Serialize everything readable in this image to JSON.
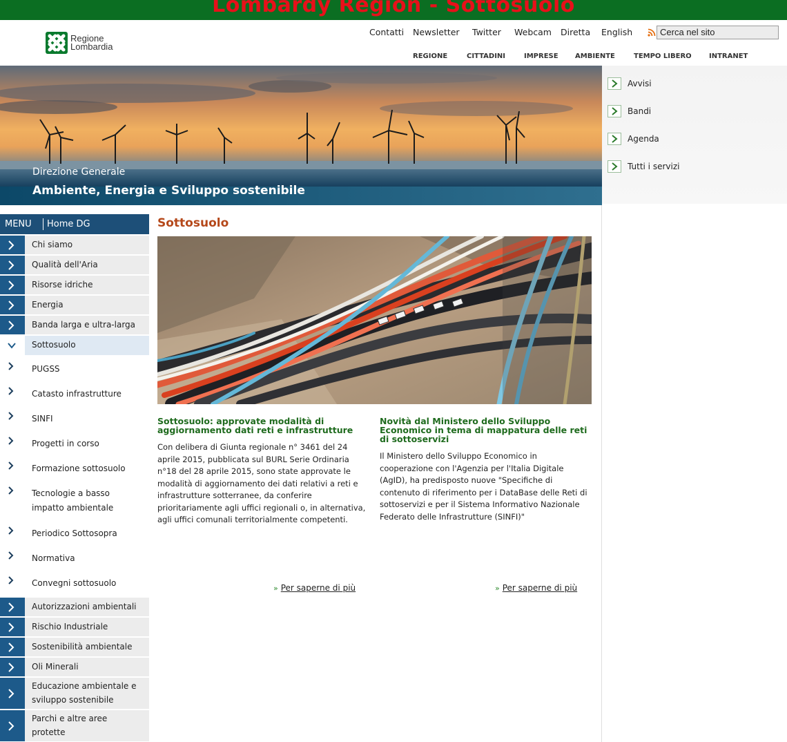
{
  "top_strip": {
    "text": "Lombardy Region - Sottosuolo"
  },
  "brand": {
    "line1": "Regione",
    "line2": "Lombardia"
  },
  "utility_links": [
    "Contatti",
    "Newsletter",
    "Twitter",
    "Webcam",
    "Diretta",
    "English"
  ],
  "search": {
    "value": "Cerca nel sito"
  },
  "main_nav": [
    "REGIONE",
    "CITTADINI",
    "IMPRESE",
    "AMBIENTE",
    "TEMPO LIBERO",
    "INTRANET"
  ],
  "banner": {
    "label": "Direzione Generale",
    "title": "Ambiente, Energia e Sviluppo sostenibile"
  },
  "quick_links": [
    "Avvisi",
    "Bandi",
    "Agenda",
    "Tutti i servizi"
  ],
  "menu": {
    "title": "MENU",
    "home": "Home DG",
    "items": [
      "Chi siamo",
      "Qualità dell'Aria",
      "Risorse idriche",
      "Energia",
      "Banda larga e ultra-larga",
      "Sottosuolo",
      "PUGSS",
      "Catasto infrastrutture",
      "SINFI",
      "Progetti in corso",
      "Formazione sottosuolo",
      "Tecnologie a basso",
      "impatto ambientale",
      "Periodico Sottosopra",
      "Normativa",
      "Convegni sottosuolo",
      "Autorizzazioni ambientali",
      "Rischio Industriale",
      "Sostenibilità ambientale",
      "Oli Minerali",
      "Educazione ambientale e",
      "sviluppo sostenibile",
      "Parchi e altre aree",
      "protette"
    ]
  },
  "content": {
    "title": "Sottosuolo",
    "news": [
      {
        "title": "Sottosuolo: approvate modalità di aggiornamento dati reti e infrastrutture",
        "body": "Con delibera di Giunta regionale n° 3461 del 24 aprile 2015, pubblicata sul BURL Serie Ordinaria n°18 del 28 aprile 2015, sono state approvate le modalità di aggiornamento dei dati relativi a reti e infrastrutture sotterranee, da conferire prioritariamente agli uffici regionali o, in alternativa, agli uffici comunali territorialmente competenti.",
        "more": "Per saperne di più"
      },
      {
        "title": "Novità dal Ministero dello Sviluppo Economico in tema di mappatura delle reti di sottoservizi",
        "body": "Il Ministero dello Sviluppo Economico in cooperazione con l'Agenzia per l'Italia Digitale (AgID), ha predisposto nuove \"Specifiche di contenuto di riferimento per i DataBase delle Reti di sottoservizi e per il Sistema Informativo Nazionale Federato delle Infrastrutture (SINFI)\"",
        "more": "Per saperne di più"
      }
    ]
  },
  "colors": {
    "top_strip": "#0b6e22",
    "top_strip_text": "#e8101a",
    "menu_blue": "#1d5a8a",
    "title_orange": "#b5481a",
    "news_green": "#1f6b1e"
  }
}
